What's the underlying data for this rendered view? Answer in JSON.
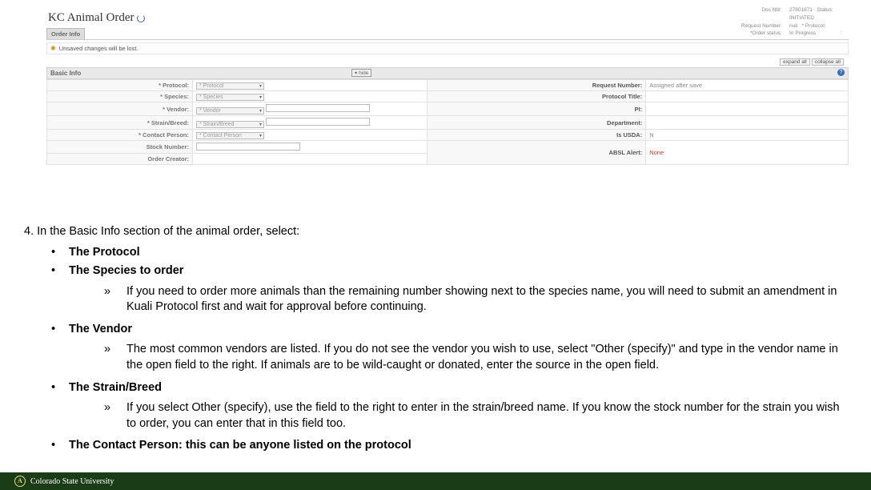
{
  "app": {
    "title": "KC Animal Order",
    "meta": {
      "docnbr_label": "Doc Nbr:",
      "docnbr_val": "27801871",
      "status_label": "Status:",
      "status_val": "INITIATED",
      "reqnum_label": "Request Number:",
      "reqnum_val": "null",
      "proto_label": "* Protocol:",
      "proto_val": "",
      "ostatus_label": "*Order status:",
      "ostatus_val": "In Progress",
      "colon": ":"
    },
    "tab": "Order Info",
    "warn": "Unsaved changes will be lost.",
    "buttons": {
      "expand": "expand all",
      "collapse": "collapse all",
      "hide": "▾ hide"
    },
    "section": "Basic Info",
    "fields": {
      "protocol_l": "* Protocol:",
      "protocol_v": "* Protocol",
      "species_l": "* Species:",
      "species_v": "* Species",
      "vendor_l": "* Vendor:",
      "vendor_v": "* Vendor",
      "strain_l": "* Strain/Breed:",
      "strain_v": "* Strain/Breed",
      "contact_l": "* Contact Person:",
      "contact_v": "* Contact Person",
      "stock_l": "Stock Number:",
      "creator_l": "Order Creator:"
    },
    "right": {
      "reqnum_l": "Request Number:",
      "reqnum_v": "Assigned after save",
      "ptitle_l": "Protocol Title:",
      "pi_l": "PI:",
      "dept_l": "Department:",
      "usda_l": "Is USDA:",
      "usda_v": "N",
      "absl_l": "ABSL Alert:",
      "absl_v": "None"
    }
  },
  "instr": {
    "step": "4. In the Basic Info section of the animal order, select:",
    "protocol": "The Protocol",
    "species": "The Species to order",
    "species_note": "If you need to order more animals than the remaining number showing next to the species name, you will need to submit an amendment in Kuali Protocol first and wait for approval before continuing.",
    "vendor": "The Vendor",
    "vendor_note": "The most common vendors are listed. If you do not see the vendor you wish to use, select \"Other (specify)\" and type in the vendor name in the open field to the right. If animals are to be wild-caught or donated, enter the source in the open field.",
    "strain": "The Strain/Breed",
    "strain_note": "If you select Other (specify), use the field to the right to enter in the strain/breed name. If you know the stock number for the strain you wish to order, you can enter that in this field too.",
    "contact": "The Contact Person: this can be anyone listed on the protocol"
  },
  "footer": {
    "text": "Colorado State University"
  }
}
